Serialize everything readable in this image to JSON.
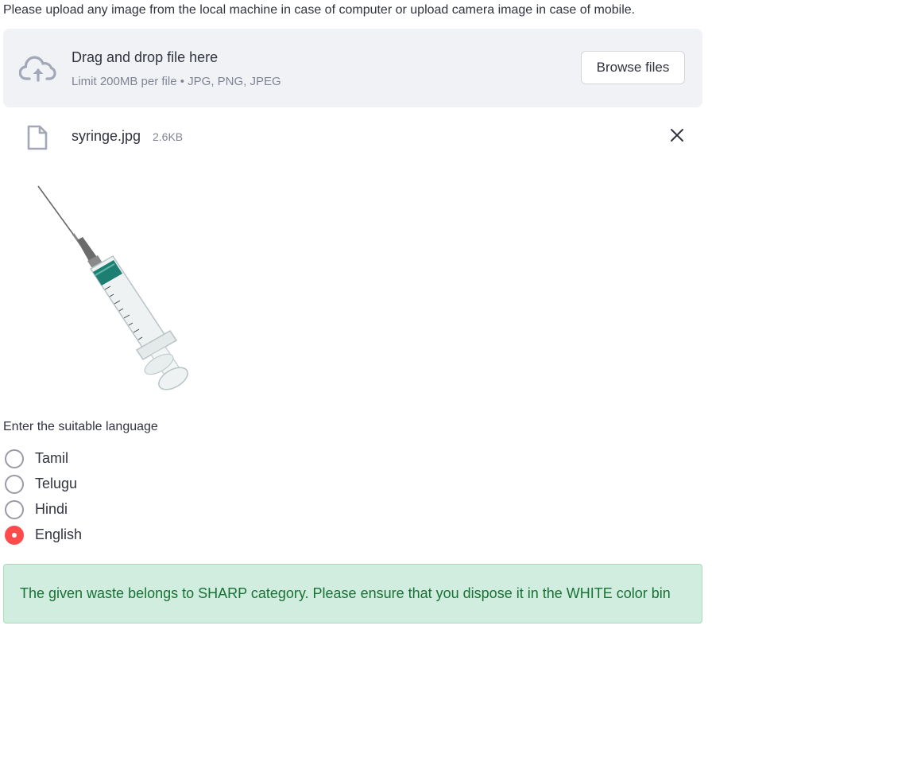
{
  "upload": {
    "prompt": "Please upload any image from the local machine in case of computer or upload camera image in case of mobile.",
    "drop_title": "Drag and drop file here",
    "limit_text": "Limit 200MB per file • JPG, PNG, JPEG",
    "browse_label": "Browse files"
  },
  "file": {
    "name": "syringe.jpg",
    "size": "2.6KB"
  },
  "language": {
    "label": "Enter the suitable language",
    "options": [
      "Tamil",
      "Telugu",
      "Hindi",
      "English"
    ],
    "selected": "English"
  },
  "result": {
    "message": "The given waste belongs to SHARP category. Please ensure that you dispose it in the WHITE color bin"
  },
  "colors": {
    "accent": "#ff4b4b",
    "dropzone_bg": "#f0f2f6",
    "success_bg": "#d1ede0",
    "success_text": "#177233"
  },
  "icons": {
    "upload": "cloud-upload-icon",
    "file": "file-icon",
    "remove": "close-icon"
  }
}
